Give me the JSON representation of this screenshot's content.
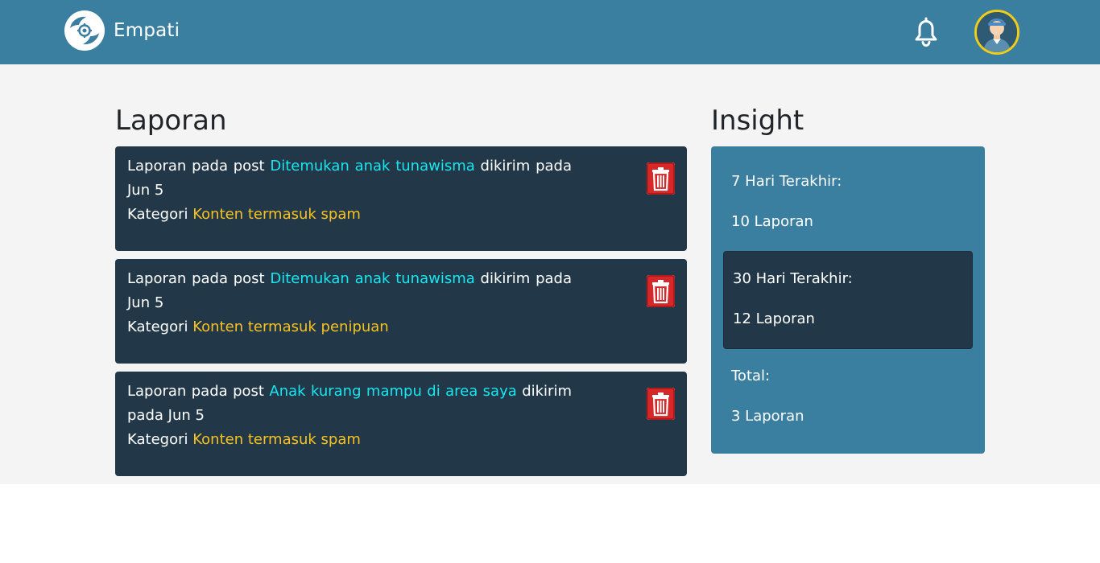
{
  "navbar": {
    "brand_name": "Empati",
    "icons": {
      "logo": "hands-heart-logo",
      "notification": "bell-icon",
      "avatar": "user-avatar"
    }
  },
  "reports_section": {
    "title": "Laporan",
    "prefix": "Laporan pada post",
    "sent_label": "dikirim",
    "on_label": "pada",
    "category_label": "Kategori",
    "items": [
      {
        "post": "Ditemukan anak tunawisma",
        "date": "Jun 5",
        "category": "Konten termasuk spam"
      },
      {
        "post": "Ditemukan anak tunawisma",
        "date": "Jun 5",
        "category": "Konten termasuk penipuan"
      },
      {
        "post": "Anak kurang mampu di area saya",
        "date": "Jun 5",
        "category": "Konten termasuk spam"
      }
    ]
  },
  "insight": {
    "title": "Insight",
    "last_7_days": {
      "label": "7 Hari Terakhir:",
      "value": "10 Laporan"
    },
    "last_30_days": {
      "label": "30 Hari Terakhir:",
      "value": "12 Laporan"
    },
    "total": {
      "label": "Total:",
      "value": "3 Laporan"
    }
  },
  "colors": {
    "navbar": "#3a7fa0",
    "card": "#223848",
    "post_link": "#18e6f0",
    "category": "#f7c221",
    "delete": "#d62828",
    "avatar_ring": "#f2cd16"
  }
}
